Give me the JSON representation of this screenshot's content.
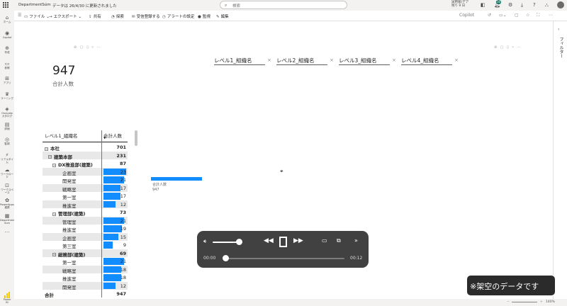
{
  "titlebar": {
    "report_name": "DepartmentSum",
    "separator": "|",
    "updated": "データは 26/4/30 に更新されました",
    "search_placeholder": "検索",
    "trial_line1": "試用版(デア",
    "trial_line2": "残り 9 日",
    "notif_count": "10"
  },
  "nav": {
    "items": [
      {
        "icon": "⌂",
        "label": "ホーム"
      },
      {
        "icon": "◉",
        "label": "Copilot"
      },
      {
        "icon": "⊕",
        "label": "作成"
      },
      {
        "icon": "▭",
        "label": "参照"
      },
      {
        "icon": "⊞",
        "label": "アプリ"
      },
      {
        "icon": "♛",
        "label": "ラーニング"
      },
      {
        "icon": "◈",
        "label": "OneLake カタログ"
      },
      {
        "icon": "▤",
        "label": "詳細"
      },
      {
        "icon": "◎",
        "label": "監視"
      },
      {
        "icon": "⚡",
        "label": "リアルタイム"
      },
      {
        "icon": "☁",
        "label": "ワークロード"
      },
      {
        "icon": "⊡",
        "label": "ワークスペース"
      },
      {
        "icon": "✿",
        "label": "PowerApps 連携"
      },
      {
        "icon": "▦",
        "label": "Department Sum"
      },
      {
        "icon": "…",
        "label": ""
      }
    ],
    "powerbi_label": "Power BI"
  },
  "toolbar": {
    "items": [
      {
        "icon": "▭",
        "label": "ファイル",
        "caret": "⌄"
      },
      {
        "icon": "→",
        "label": "エクスポート",
        "caret": "⌄"
      },
      {
        "icon": "⇪",
        "label": "共有",
        "caret": ""
      },
      {
        "icon": "◔",
        "label": "探索",
        "caret": ""
      },
      {
        "icon": "✉",
        "label": "受信登録する",
        "caret": ""
      },
      {
        "icon": "◷",
        "label": "アラートの設定",
        "caret": ""
      },
      {
        "icon": "●",
        "label": "監視",
        "caret": ""
      },
      {
        "icon": "✎",
        "label": "編集",
        "caret": ""
      }
    ],
    "right_label": "Copilot"
  },
  "filter_pane": {
    "label": "フィルター"
  },
  "card": {
    "value": "947",
    "label": "合計人数"
  },
  "slicers": [
    "レベル1_組織名",
    "レベル2_組織名",
    "レベル3_組織名",
    "レベル4_組織名"
  ],
  "matrix": {
    "col1": "レベル1_組織名",
    "col2": "合計人数",
    "sort_indicator": "▼",
    "max_value": 23,
    "rows": [
      {
        "level": 0,
        "toggle": "−",
        "label": "本社",
        "value": 701,
        "bold": true,
        "shade": false,
        "bar": false
      },
      {
        "level": 1,
        "toggle": "−",
        "label": "建築本部",
        "value": 231,
        "bold": true,
        "shade": true,
        "bar": false
      },
      {
        "level": 2,
        "toggle": "−",
        "label": "DX推進部(建築)",
        "value": 87,
        "bold": true,
        "shade": false,
        "bar": false
      },
      {
        "level": 3,
        "toggle": "",
        "label": "企画室",
        "value": 23,
        "bold": false,
        "shade": true,
        "bar": true
      },
      {
        "level": 3,
        "toggle": "",
        "label": "開発室",
        "value": 21,
        "bold": false,
        "shade": false,
        "bar": true
      },
      {
        "level": 3,
        "toggle": "",
        "label": "戦略室",
        "value": 17,
        "bold": false,
        "shade": true,
        "bar": true
      },
      {
        "level": 3,
        "toggle": "",
        "label": "第一室",
        "value": 17,
        "bold": false,
        "shade": false,
        "bar": true
      },
      {
        "level": 3,
        "toggle": "",
        "label": "推進室",
        "value": 12,
        "bold": false,
        "shade": true,
        "bar": true
      },
      {
        "level": 2,
        "toggle": "−",
        "label": "管理部(建築)",
        "value": 73,
        "bold": true,
        "shade": false,
        "bar": false
      },
      {
        "level": 3,
        "toggle": "",
        "label": "管理室",
        "value": 21,
        "bold": false,
        "shade": true,
        "bar": true
      },
      {
        "level": 3,
        "toggle": "",
        "label": "推進室",
        "value": 19,
        "bold": false,
        "shade": false,
        "bar": true
      },
      {
        "level": 3,
        "toggle": "",
        "label": "企画室",
        "value": 15,
        "bold": false,
        "shade": true,
        "bar": true
      },
      {
        "level": 3,
        "toggle": "",
        "label": "第三室",
        "value": 9,
        "bold": false,
        "shade": false,
        "bar": true
      },
      {
        "level": 2,
        "toggle": "−",
        "label": "総務部(建築)",
        "value": 69,
        "bold": true,
        "shade": true,
        "bar": false
      },
      {
        "level": 3,
        "toggle": "",
        "label": "第一室",
        "value": 21,
        "bold": false,
        "shade": false,
        "bar": true
      },
      {
        "level": 3,
        "toggle": "",
        "label": "戦略室",
        "value": 18,
        "bold": false,
        "shade": true,
        "bar": true
      },
      {
        "level": 3,
        "toggle": "",
        "label": "推進室",
        "value": 18,
        "bold": false,
        "shade": false,
        "bar": true
      },
      {
        "level": 3,
        "toggle": "",
        "label": "開発室",
        "value": 12,
        "bold": false,
        "shade": true,
        "bar": true
      },
      {
        "level": 0,
        "toggle": "",
        "label": "合計",
        "value": 947,
        "bold": true,
        "shade": false,
        "bar": false
      }
    ]
  },
  "mini_chart": {
    "label": "合計人数",
    "value": "947"
  },
  "visual_header_icons": "⊘ ▢ ▯ ▿ ⋯",
  "player": {
    "time_current": "00:00",
    "time_total": "00:12",
    "progress": 0.0,
    "volume": 0.85
  },
  "watermark": "※架空のデータです",
  "bottombar": {
    "zoom": "140%"
  },
  "colors": {
    "accent": "#118dff",
    "teal": "#117865"
  }
}
